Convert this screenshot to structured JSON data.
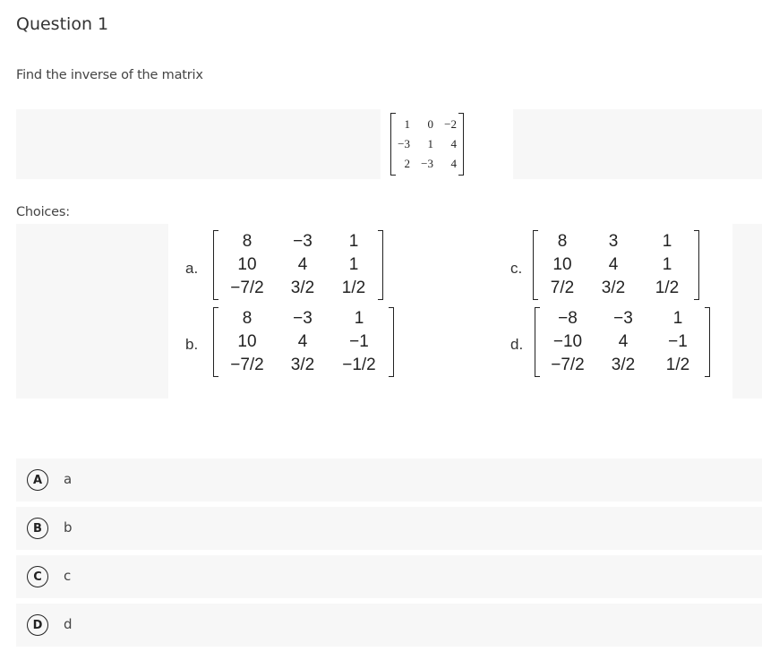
{
  "question": {
    "title": "Question 1",
    "prompt": "Find the inverse of the matrix",
    "matrix": [
      [
        "1",
        "0",
        "−2"
      ],
      [
        "−3",
        "1",
        "4"
      ],
      [
        "2",
        "−3",
        "4"
      ]
    ]
  },
  "choices_label": "Choices:",
  "choices": [
    {
      "letter": "a.",
      "matrix": [
        [
          "8",
          "−3",
          "1"
        ],
        [
          "10",
          "4",
          "1"
        ],
        [
          "−7/2",
          "3/2",
          "1/2"
        ]
      ]
    },
    {
      "letter": "b.",
      "matrix": [
        [
          "8",
          "−3",
          "1"
        ],
        [
          "10",
          "4",
          "−1"
        ],
        [
          "−7/2",
          "3/2",
          "−1/2"
        ]
      ]
    },
    {
      "letter": "c.",
      "matrix": [
        [
          "8",
          "3",
          "1"
        ],
        [
          "10",
          "4",
          "1"
        ],
        [
          "7/2",
          "3/2",
          "1/2"
        ]
      ]
    },
    {
      "letter": "d.",
      "matrix": [
        [
          "−8",
          "−3",
          "1"
        ],
        [
          "−10",
          "4",
          "−1"
        ],
        [
          "−7/2",
          "3/2",
          "1/2"
        ]
      ]
    }
  ],
  "answers": [
    {
      "badge": "A",
      "label": "a"
    },
    {
      "badge": "B",
      "label": "b"
    },
    {
      "badge": "C",
      "label": "c"
    },
    {
      "badge": "D",
      "label": "d"
    }
  ]
}
